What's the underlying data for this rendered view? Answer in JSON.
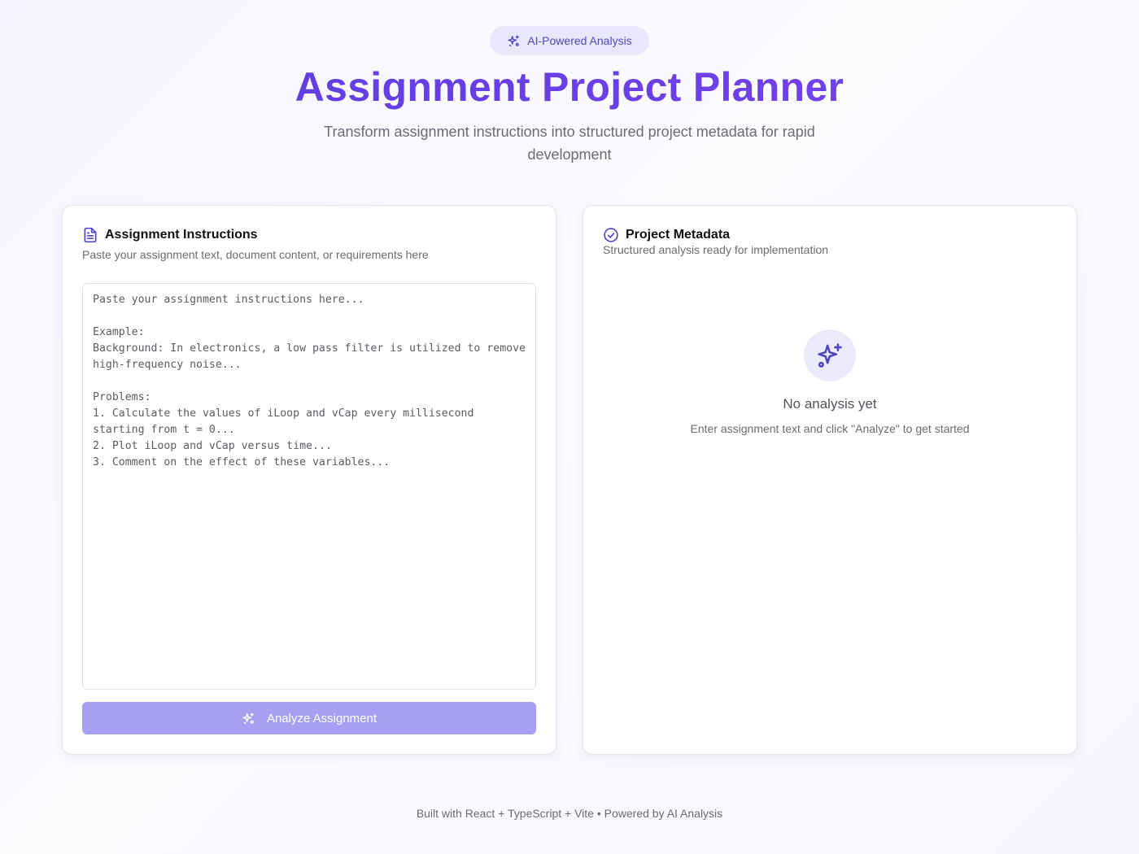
{
  "header": {
    "badge": "AI-Powered Analysis",
    "title": "Assignment Project Planner",
    "subtitle": "Transform assignment instructions into structured project metadata for rapid development"
  },
  "input_panel": {
    "icon": "document-icon",
    "title": "Assignment Instructions",
    "description": "Paste your assignment text, document content, or requirements here",
    "textarea_value": "",
    "textarea_placeholder": "Paste your assignment instructions here...\n\nExample:\nBackground: In electronics, a low pass filter is utilized to remove high-frequency noise...\n\nProblems:\n1. Calculate the values of iLoop and vCap every millisecond starting from t = 0...\n2. Plot iLoop and vCap versus time...\n3. Comment on the effect of these variables...",
    "analyze_button": "Analyze Assignment",
    "button_color": "#a7a0f2"
  },
  "output_panel": {
    "icon": "check-circle-icon",
    "title": "Project Metadata",
    "description": "Structured analysis ready for implementation",
    "empty_icon": "sparkles-icon",
    "empty_title": "No analysis yet",
    "empty_description": "Enter assignment text and click \"Analyze\" to get started"
  },
  "footer": {
    "text": "Built with React + TypeScript + Vite • Powered by AI Analysis"
  },
  "colors": {
    "accent": "#5a3fe0",
    "badge_bg": "#e9e7fb",
    "badge_text": "#4f46c5"
  }
}
